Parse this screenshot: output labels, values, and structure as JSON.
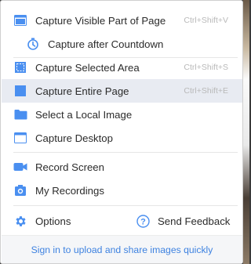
{
  "menu": {
    "items": [
      {
        "label": "Capture Visible Part of Page",
        "shortcut": "Ctrl+Shift+V",
        "icon": "window-icon"
      },
      {
        "label": "Capture after Countdown",
        "shortcut": "",
        "icon": "timer-icon"
      },
      {
        "label": "Capture Selected Area",
        "shortcut": "Ctrl+Shift+S",
        "icon": "selection-icon"
      },
      {
        "label": "Capture Entire Page",
        "shortcut": "Ctrl+Shift+E",
        "icon": "page-icon"
      },
      {
        "label": "Select a Local Image",
        "shortcut": "",
        "icon": "folder-icon"
      },
      {
        "label": "Capture Desktop",
        "shortcut": "",
        "icon": "desktop-icon"
      },
      {
        "label": "Record Screen",
        "shortcut": "",
        "icon": "video-camera-icon"
      },
      {
        "label": "My Recordings",
        "shortcut": "",
        "icon": "recordings-icon"
      }
    ],
    "options_label": "Options",
    "feedback_label": "Send Feedback",
    "footer_link": "Sign in to upload and share images quickly"
  },
  "colors": {
    "accent": "#3e82e0",
    "icon_blue": "#4a8ff0",
    "hover_bg": "#e8ebf2",
    "shortcut_text": "#b9b9b9"
  }
}
